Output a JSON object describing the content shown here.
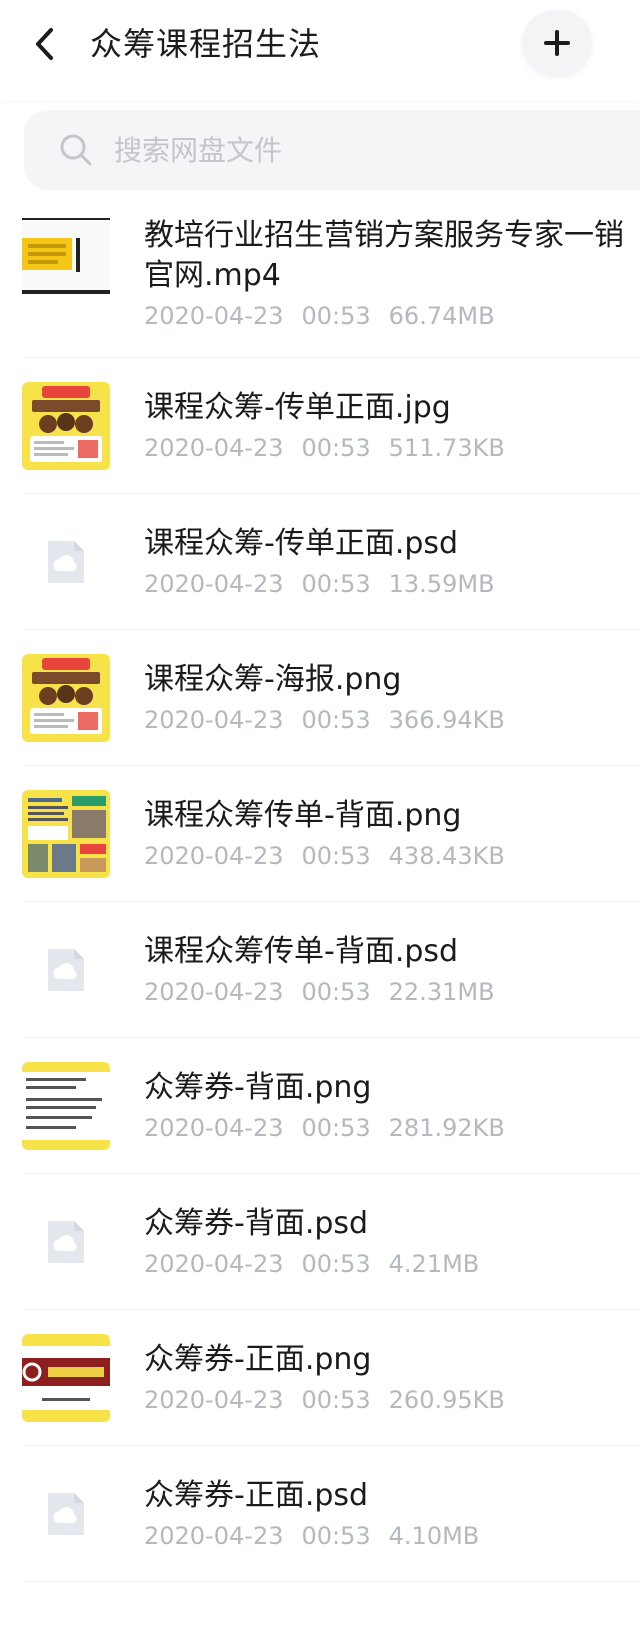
{
  "header": {
    "title": "众筹课程招生法",
    "back_icon": "chevron-left-icon",
    "add_icon": "plus-icon"
  },
  "search": {
    "placeholder": "搜索网盘文件",
    "icon": "search-icon"
  },
  "files": [
    {
      "name": "教培行业招生营销方案服务专家一销官网.mp4",
      "date": "2020-04-23",
      "time": "00:53",
      "size": "66.74MB",
      "thumb": "video"
    },
    {
      "name": "课程众筹-传单正面.jpg",
      "date": "2020-04-23",
      "time": "00:53",
      "size": "511.73KB",
      "thumb": "flyer"
    },
    {
      "name": "课程众筹-传单正面.psd",
      "date": "2020-04-23",
      "time": "00:53",
      "size": "13.59MB",
      "thumb": "generic"
    },
    {
      "name": "课程众筹-海报.png",
      "date": "2020-04-23",
      "time": "00:53",
      "size": "366.94KB",
      "thumb": "flyer"
    },
    {
      "name": "课程众筹传单-背面.png",
      "date": "2020-04-23",
      "time": "00:53",
      "size": "438.43KB",
      "thumb": "back"
    },
    {
      "name": "课程众筹传单-背面.psd",
      "date": "2020-04-23",
      "time": "00:53",
      "size": "22.31MB",
      "thumb": "generic"
    },
    {
      "name": "众筹券-背面.png",
      "date": "2020-04-23",
      "time": "00:53",
      "size": "281.92KB",
      "thumb": "coupon-back"
    },
    {
      "name": "众筹券-背面.psd",
      "date": "2020-04-23",
      "time": "00:53",
      "size": "4.21MB",
      "thumb": "generic"
    },
    {
      "name": "众筹券-正面.png",
      "date": "2020-04-23",
      "time": "00:53",
      "size": "260.95KB",
      "thumb": "coupon-front"
    },
    {
      "name": "众筹券-正面.psd",
      "date": "2020-04-23",
      "time": "00:53",
      "size": "4.10MB",
      "thumb": "generic"
    }
  ],
  "colors": {
    "thumb_yellow": "#f7e24a",
    "generic_icon_bg": "#e4e8ee",
    "meta_text": "#b4b8bf"
  }
}
